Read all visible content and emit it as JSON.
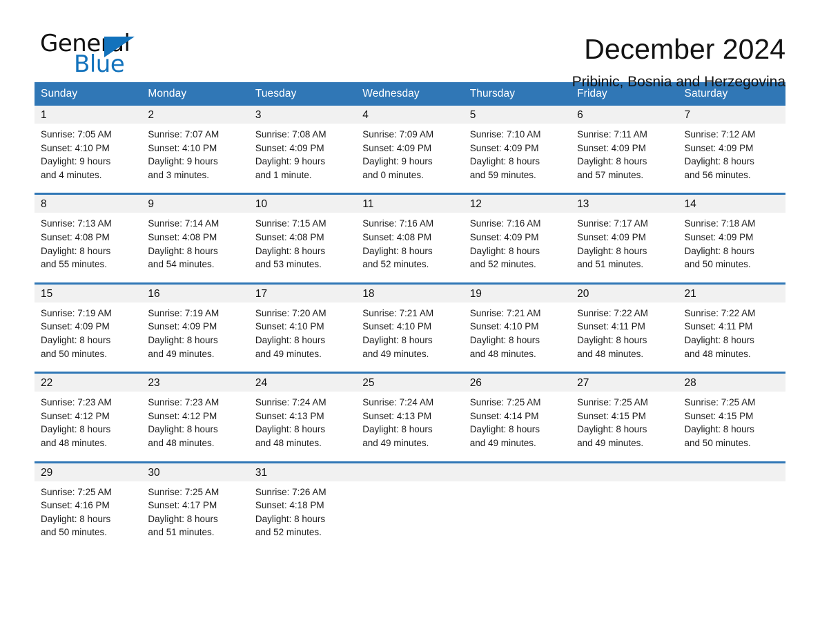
{
  "logo": {
    "word_one": "General",
    "word_two": "Blue",
    "triangle_icon": "blue-triangle-icon",
    "brand_blue": "#1272BC"
  },
  "header": {
    "title": "December 2024",
    "location": "Pribinic, Bosnia and Herzegovina"
  },
  "colors": {
    "header_blue": "#3077B6",
    "daynum_gray": "#f1f1f1",
    "text": "#111111"
  },
  "calendar": {
    "weekday_headers": [
      "Sunday",
      "Monday",
      "Tuesday",
      "Wednesday",
      "Thursday",
      "Friday",
      "Saturday"
    ],
    "weeks": [
      [
        {
          "day": "1",
          "sunrise": "Sunrise: 7:05 AM",
          "sunset": "Sunset: 4:10 PM",
          "daylight_line1": "Daylight: 9 hours",
          "daylight_line2": "and 4 minutes."
        },
        {
          "day": "2",
          "sunrise": "Sunrise: 7:07 AM",
          "sunset": "Sunset: 4:10 PM",
          "daylight_line1": "Daylight: 9 hours",
          "daylight_line2": "and 3 minutes."
        },
        {
          "day": "3",
          "sunrise": "Sunrise: 7:08 AM",
          "sunset": "Sunset: 4:09 PM",
          "daylight_line1": "Daylight: 9 hours",
          "daylight_line2": "and 1 minute."
        },
        {
          "day": "4",
          "sunrise": "Sunrise: 7:09 AM",
          "sunset": "Sunset: 4:09 PM",
          "daylight_line1": "Daylight: 9 hours",
          "daylight_line2": "and 0 minutes."
        },
        {
          "day": "5",
          "sunrise": "Sunrise: 7:10 AM",
          "sunset": "Sunset: 4:09 PM",
          "daylight_line1": "Daylight: 8 hours",
          "daylight_line2": "and 59 minutes."
        },
        {
          "day": "6",
          "sunrise": "Sunrise: 7:11 AM",
          "sunset": "Sunset: 4:09 PM",
          "daylight_line1": "Daylight: 8 hours",
          "daylight_line2": "and 57 minutes."
        },
        {
          "day": "7",
          "sunrise": "Sunrise: 7:12 AM",
          "sunset": "Sunset: 4:09 PM",
          "daylight_line1": "Daylight: 8 hours",
          "daylight_line2": "and 56 minutes."
        }
      ],
      [
        {
          "day": "8",
          "sunrise": "Sunrise: 7:13 AM",
          "sunset": "Sunset: 4:08 PM",
          "daylight_line1": "Daylight: 8 hours",
          "daylight_line2": "and 55 minutes."
        },
        {
          "day": "9",
          "sunrise": "Sunrise: 7:14 AM",
          "sunset": "Sunset: 4:08 PM",
          "daylight_line1": "Daylight: 8 hours",
          "daylight_line2": "and 54 minutes."
        },
        {
          "day": "10",
          "sunrise": "Sunrise: 7:15 AM",
          "sunset": "Sunset: 4:08 PM",
          "daylight_line1": "Daylight: 8 hours",
          "daylight_line2": "and 53 minutes."
        },
        {
          "day": "11",
          "sunrise": "Sunrise: 7:16 AM",
          "sunset": "Sunset: 4:08 PM",
          "daylight_line1": "Daylight: 8 hours",
          "daylight_line2": "and 52 minutes."
        },
        {
          "day": "12",
          "sunrise": "Sunrise: 7:16 AM",
          "sunset": "Sunset: 4:09 PM",
          "daylight_line1": "Daylight: 8 hours",
          "daylight_line2": "and 52 minutes."
        },
        {
          "day": "13",
          "sunrise": "Sunrise: 7:17 AM",
          "sunset": "Sunset: 4:09 PM",
          "daylight_line1": "Daylight: 8 hours",
          "daylight_line2": "and 51 minutes."
        },
        {
          "day": "14",
          "sunrise": "Sunrise: 7:18 AM",
          "sunset": "Sunset: 4:09 PM",
          "daylight_line1": "Daylight: 8 hours",
          "daylight_line2": "and 50 minutes."
        }
      ],
      [
        {
          "day": "15",
          "sunrise": "Sunrise: 7:19 AM",
          "sunset": "Sunset: 4:09 PM",
          "daylight_line1": "Daylight: 8 hours",
          "daylight_line2": "and 50 minutes."
        },
        {
          "day": "16",
          "sunrise": "Sunrise: 7:19 AM",
          "sunset": "Sunset: 4:09 PM",
          "daylight_line1": "Daylight: 8 hours",
          "daylight_line2": "and 49 minutes."
        },
        {
          "day": "17",
          "sunrise": "Sunrise: 7:20 AM",
          "sunset": "Sunset: 4:10 PM",
          "daylight_line1": "Daylight: 8 hours",
          "daylight_line2": "and 49 minutes."
        },
        {
          "day": "18",
          "sunrise": "Sunrise: 7:21 AM",
          "sunset": "Sunset: 4:10 PM",
          "daylight_line1": "Daylight: 8 hours",
          "daylight_line2": "and 49 minutes."
        },
        {
          "day": "19",
          "sunrise": "Sunrise: 7:21 AM",
          "sunset": "Sunset: 4:10 PM",
          "daylight_line1": "Daylight: 8 hours",
          "daylight_line2": "and 48 minutes."
        },
        {
          "day": "20",
          "sunrise": "Sunrise: 7:22 AM",
          "sunset": "Sunset: 4:11 PM",
          "daylight_line1": "Daylight: 8 hours",
          "daylight_line2": "and 48 minutes."
        },
        {
          "day": "21",
          "sunrise": "Sunrise: 7:22 AM",
          "sunset": "Sunset: 4:11 PM",
          "daylight_line1": "Daylight: 8 hours",
          "daylight_line2": "and 48 minutes."
        }
      ],
      [
        {
          "day": "22",
          "sunrise": "Sunrise: 7:23 AM",
          "sunset": "Sunset: 4:12 PM",
          "daylight_line1": "Daylight: 8 hours",
          "daylight_line2": "and 48 minutes."
        },
        {
          "day": "23",
          "sunrise": "Sunrise: 7:23 AM",
          "sunset": "Sunset: 4:12 PM",
          "daylight_line1": "Daylight: 8 hours",
          "daylight_line2": "and 48 minutes."
        },
        {
          "day": "24",
          "sunrise": "Sunrise: 7:24 AM",
          "sunset": "Sunset: 4:13 PM",
          "daylight_line1": "Daylight: 8 hours",
          "daylight_line2": "and 48 minutes."
        },
        {
          "day": "25",
          "sunrise": "Sunrise: 7:24 AM",
          "sunset": "Sunset: 4:13 PM",
          "daylight_line1": "Daylight: 8 hours",
          "daylight_line2": "and 49 minutes."
        },
        {
          "day": "26",
          "sunrise": "Sunrise: 7:25 AM",
          "sunset": "Sunset: 4:14 PM",
          "daylight_line1": "Daylight: 8 hours",
          "daylight_line2": "and 49 minutes."
        },
        {
          "day": "27",
          "sunrise": "Sunrise: 7:25 AM",
          "sunset": "Sunset: 4:15 PM",
          "daylight_line1": "Daylight: 8 hours",
          "daylight_line2": "and 49 minutes."
        },
        {
          "day": "28",
          "sunrise": "Sunrise: 7:25 AM",
          "sunset": "Sunset: 4:15 PM",
          "daylight_line1": "Daylight: 8 hours",
          "daylight_line2": "and 50 minutes."
        }
      ],
      [
        {
          "day": "29",
          "sunrise": "Sunrise: 7:25 AM",
          "sunset": "Sunset: 4:16 PM",
          "daylight_line1": "Daylight: 8 hours",
          "daylight_line2": "and 50 minutes."
        },
        {
          "day": "30",
          "sunrise": "Sunrise: 7:25 AM",
          "sunset": "Sunset: 4:17 PM",
          "daylight_line1": "Daylight: 8 hours",
          "daylight_line2": "and 51 minutes."
        },
        {
          "day": "31",
          "sunrise": "Sunrise: 7:26 AM",
          "sunset": "Sunset: 4:18 PM",
          "daylight_line1": "Daylight: 8 hours",
          "daylight_line2": "and 52 minutes."
        },
        {
          "day": "",
          "sunrise": "",
          "sunset": "",
          "daylight_line1": "",
          "daylight_line2": ""
        },
        {
          "day": "",
          "sunrise": "",
          "sunset": "",
          "daylight_line1": "",
          "daylight_line2": ""
        },
        {
          "day": "",
          "sunrise": "",
          "sunset": "",
          "daylight_line1": "",
          "daylight_line2": ""
        },
        {
          "day": "",
          "sunrise": "",
          "sunset": "",
          "daylight_line1": "",
          "daylight_line2": ""
        }
      ]
    ]
  }
}
